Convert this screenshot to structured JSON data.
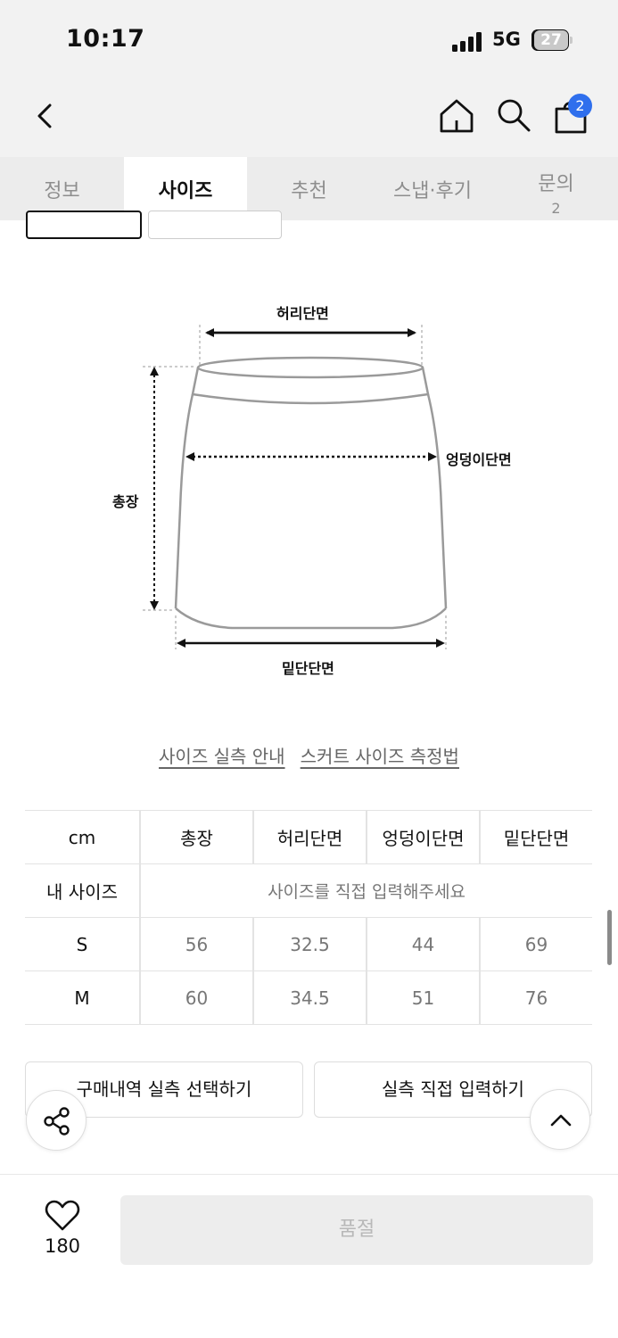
{
  "status": {
    "time": "10:17",
    "network": "5G",
    "battery": "27"
  },
  "nav": {
    "cart_count": "2"
  },
  "tabs": [
    {
      "label": "정보"
    },
    {
      "label": "사이즈"
    },
    {
      "label": "추천"
    },
    {
      "label": "스냅·후기"
    },
    {
      "label": "문의",
      "count": "2"
    }
  ],
  "diagram": {
    "waist": "허리단면",
    "hip": "엉덩이단면",
    "length": "총장",
    "hem": "밑단단면"
  },
  "links": {
    "guide": "사이즈 실측 안내",
    "method": "스커트 사이즈 측정법"
  },
  "table": {
    "unit": "cm",
    "headers": [
      "총장",
      "허리단면",
      "엉덩이단면",
      "밑단단면"
    ],
    "my_size_label": "내 사이즈",
    "my_size_placeholder": "사이즈를 직접 입력해주세요",
    "rows": [
      {
        "size": "S",
        "values": [
          "56",
          "32.5",
          "44",
          "69"
        ]
      },
      {
        "size": "M",
        "values": [
          "60",
          "34.5",
          "51",
          "76"
        ]
      }
    ]
  },
  "actions": {
    "select_history": "구매내역 실측 선택하기",
    "direct_input": "실측 직접 입력하기"
  },
  "bottom": {
    "like_count": "180",
    "soldout": "품절"
  },
  "colors": {
    "accent_badge": "#2f6fed",
    "tab_bg": "#ececec",
    "header_bg": "#f2f2f2"
  }
}
